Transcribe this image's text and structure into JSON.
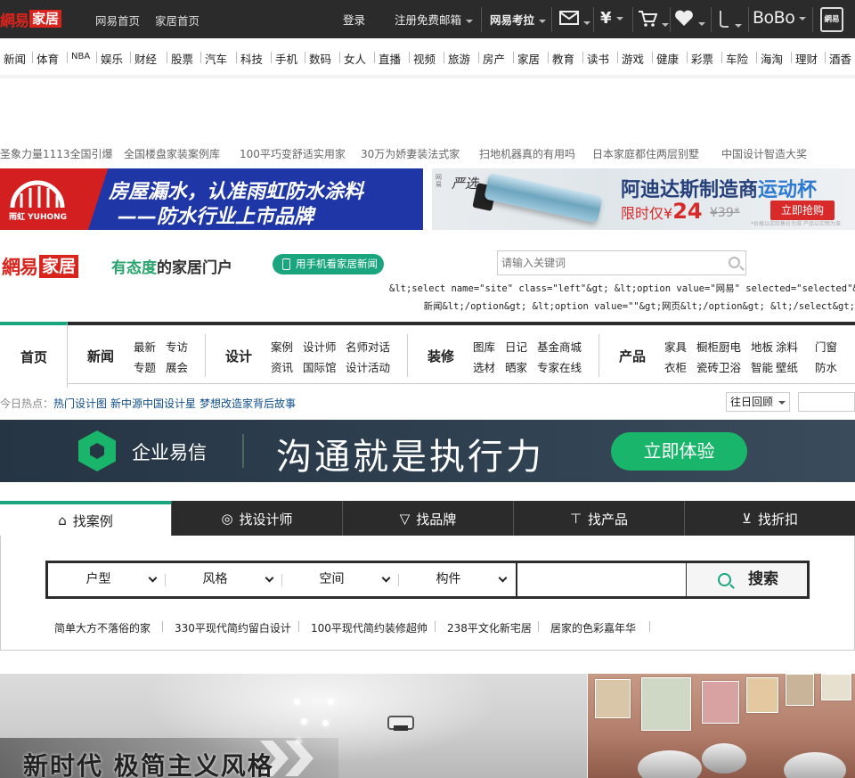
{
  "topbar": {
    "logo_brand": "網易",
    "logo_channel": "家居",
    "links": [
      "网易首页",
      "家居首页"
    ],
    "right": {
      "login": "登录",
      "register": "注册免费邮箱",
      "kaola": "网易考拉",
      "bobo": "BoBo"
    },
    "icons": [
      "mail-icon",
      "yen-icon",
      "cart-icon",
      "heart-icon",
      "phone-handset-icon",
      "mobile-app-icon"
    ],
    "mobile_label": "網易"
  },
  "nav": [
    "新闻",
    "体育",
    "NBA",
    "娱乐",
    "财经",
    "股票",
    "汽车",
    "科技",
    "手机",
    "数码",
    "女人",
    "直播",
    "视频",
    "旅游",
    "房产",
    "家居",
    "教育",
    "读书",
    "游戏",
    "健康",
    "彩票",
    "车险",
    "海淘",
    "理财",
    "酒香"
  ],
  "hot_links": [
    "圣象力量1113全国引爆",
    "全国楼盘家装案例库",
    "100平巧变舒适实用家",
    "30万为娇妻装法式家",
    "扫地机器真的有用吗",
    "日本家庭都住两层别墅",
    "中国设计智造大奖"
  ],
  "banner_left": {
    "line1": "房屋漏水，认准雨虹防水涂料",
    "line2": "——防水行业上市品牌",
    "brand": "雨虹 YUHONG",
    "color": "#1f36a6"
  },
  "banner_right": {
    "brand_small": "网易",
    "brand": "严选",
    "headline_a": "阿迪达斯制造商",
    "headline_b": "运动杯",
    "price_prefix": "限时仅¥",
    "price": "24",
    "old_price": "¥39*",
    "button": "立即抢购",
    "fine_print": "*价格以实际售价为准 产品以实物为准"
  },
  "site_header": {
    "logo_brand": "網易",
    "logo_channel": "家居",
    "slogan_a": "有态度",
    "slogan_b": "的家居门户",
    "mobile_btn": "用手机看家居新闻",
    "search_placeholder": "请输入关键词",
    "code_line1": "&lt;select name=\"site\" class=\"left\"&gt; &lt;option value=\"网易\" selected=\"selected\"&gt;",
    "code_line2": "新闻&lt;/option&gt; &lt;option value=\"\"&gt;网页&lt;/option&gt; &lt;/select&gt;"
  },
  "mainnav": {
    "home": "首页",
    "sections": [
      {
        "title": "新闻",
        "links": [
          "最新",
          "专访",
          "专题",
          "展会"
        ]
      },
      {
        "title": "设计",
        "links": [
          "案例",
          "设计师",
          "名师对话",
          "资讯",
          "国际馆",
          "设计活动"
        ]
      },
      {
        "title": "装修",
        "links": [
          "图库",
          "日记",
          "基金商城",
          "选材",
          "晒家",
          "专家在线"
        ]
      },
      {
        "title": "产品",
        "links": [
          "家具",
          "橱柜厨电",
          "地板",
          "涂料",
          "门窗",
          "衣柜",
          "瓷砖卫浴",
          "智能",
          "壁纸",
          "防水"
        ]
      }
    ]
  },
  "today": {
    "label": "今日热点：",
    "links": [
      "热门设计图",
      "新中源中国设计星",
      "梦想改造家背后故事"
    ],
    "select": "往日回顾"
  },
  "banner_enterprise": {
    "name": "企业易信",
    "slogan": "沟通就是执行力",
    "button": "立即体验"
  },
  "search_tabs": [
    "找案例",
    "找设计师",
    "找品牌",
    "找产品",
    "找折扣"
  ],
  "search_tab_icons": [
    "house-icon",
    "bulb-icon",
    "trophy-icon",
    "paint-roller-icon",
    "cart-icon"
  ],
  "filters": [
    "户型",
    "风格",
    "空间",
    "构件"
  ],
  "search_button": "搜索",
  "tags": [
    "简单大方不落俗的家",
    "330平现代简约留白设计",
    "100平现代简约装修超帅",
    "238平文化新宅居",
    "居家的色彩嘉年华"
  ],
  "feature": {
    "caption": "新时代 极简主义风格"
  }
}
